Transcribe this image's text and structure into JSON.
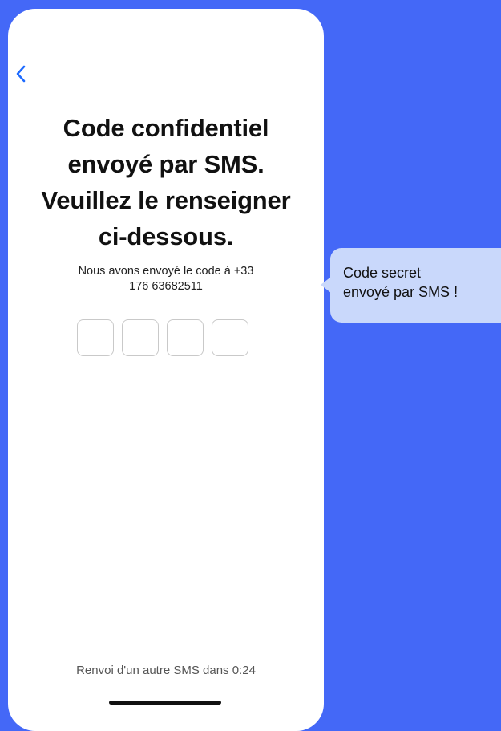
{
  "screen": {
    "title_lines": [
      "Code confidentiel",
      "envoyé par SMS.",
      "Veuillez le renseigner",
      "ci-dessous."
    ],
    "subtitle_lines": [
      "Nous avons envoyé le code à +33",
      "176 63682511"
    ],
    "code_digits": [
      "",
      "",
      "",
      ""
    ],
    "resend_text": "Renvoi d'un autre SMS dans 0:24",
    "back_icon": "chevron-left-icon"
  },
  "annotation": {
    "lines": [
      "Code secret",
      "envoyé par SMS !"
    ]
  },
  "colors": {
    "background": "#4468F7",
    "bubble": "#C9D8FB",
    "back_chevron": "#1E6BFF",
    "code_box_border": "#C9C9C9"
  }
}
